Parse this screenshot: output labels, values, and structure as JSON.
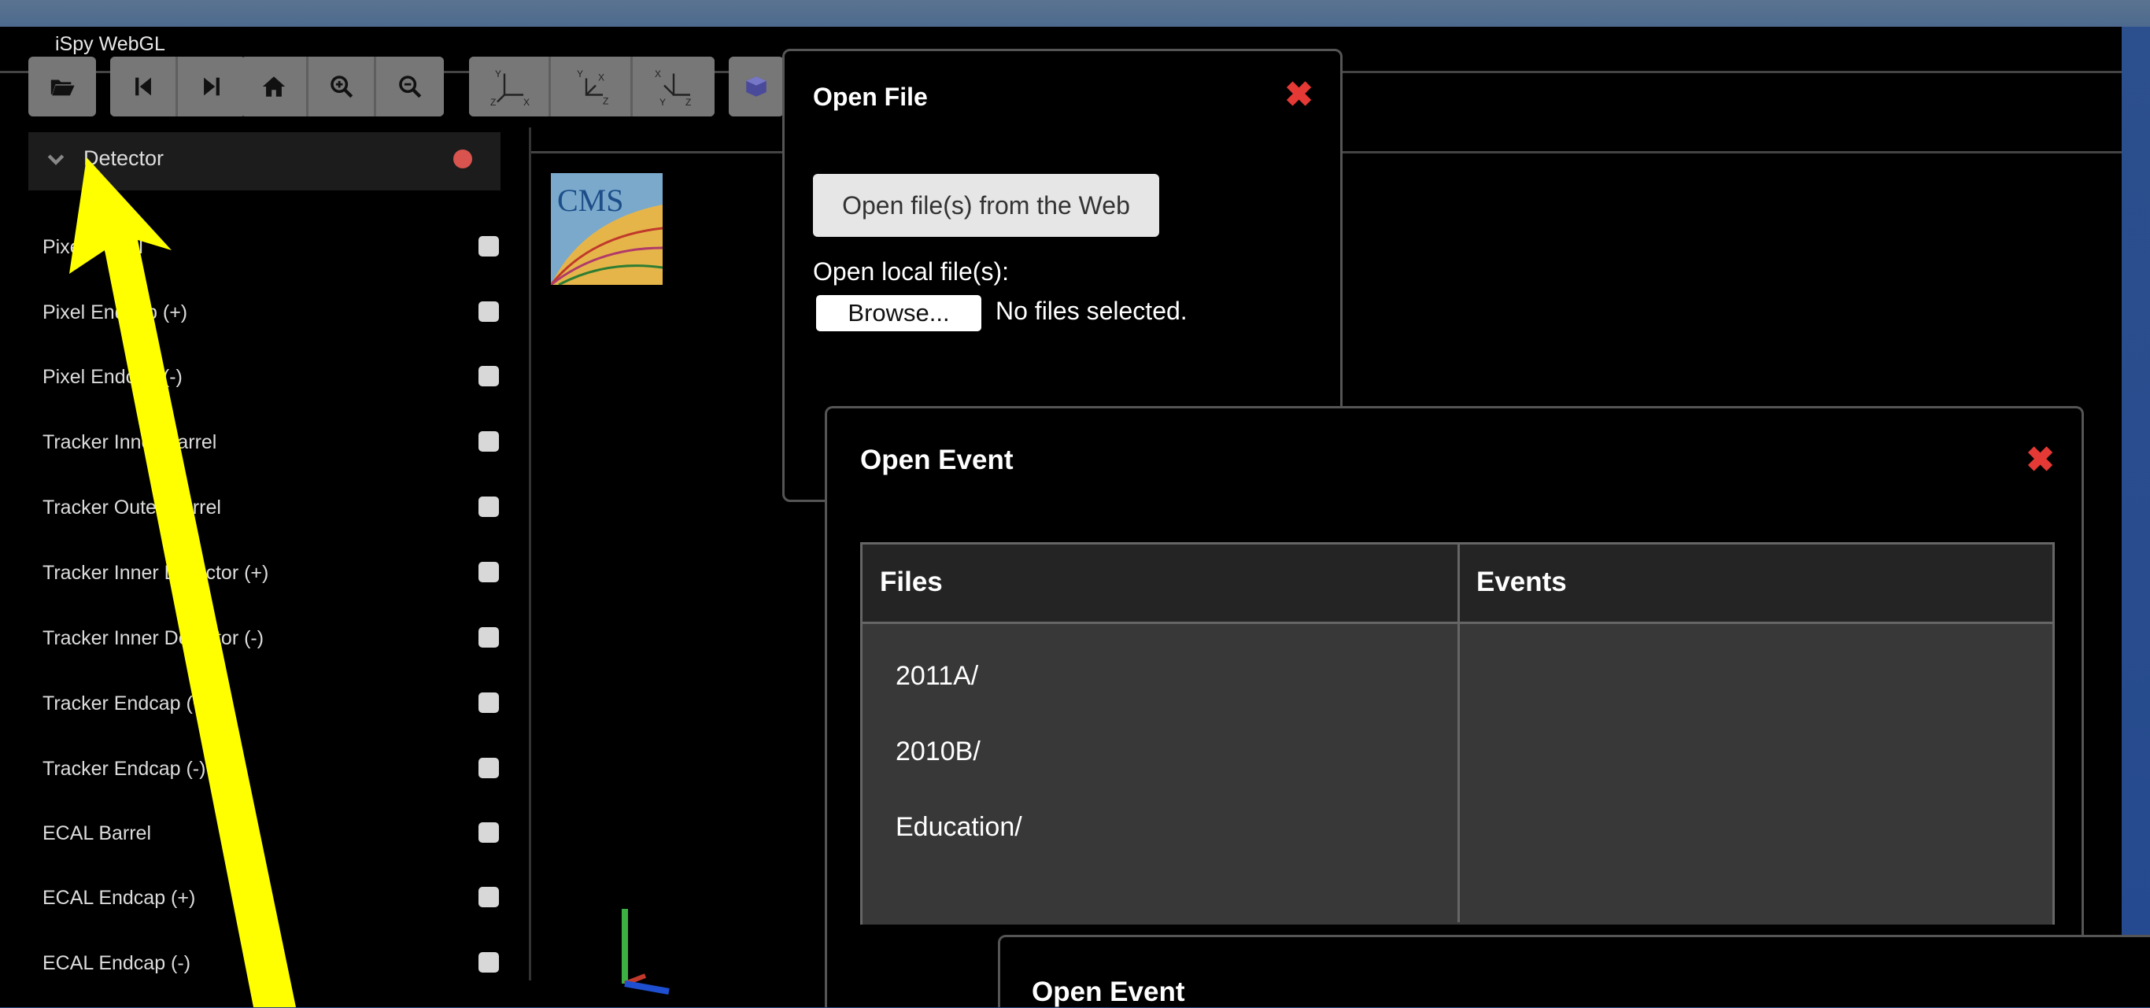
{
  "app": {
    "title": "iSpy WebGL"
  },
  "toolbar": {
    "buttons": [
      "folder-open-icon",
      "step-backward-icon",
      "step-forward-icon",
      "home-icon",
      "zoom-in-icon",
      "zoom-out-icon",
      "view-yx-icon",
      "view-yz-icon",
      "view-xy-icon",
      "cube-icon"
    ]
  },
  "sidebar": {
    "header": "Detector",
    "items": [
      {
        "label": "Pixel Barrel"
      },
      {
        "label": "Pixel Endcap (+)"
      },
      {
        "label": "Pixel Endcap (-)"
      },
      {
        "label": "Tracker Inner Barrel"
      },
      {
        "label": "Tracker Outer Barrel"
      },
      {
        "label": "Tracker Inner Detector (+)"
      },
      {
        "label": "Tracker Inner Detector (-)"
      },
      {
        "label": "Tracker Endcap (+)"
      },
      {
        "label": "Tracker Endcap (-)"
      },
      {
        "label": "ECAL Barrel"
      },
      {
        "label": "ECAL Endcap (+)"
      },
      {
        "label": "ECAL Endcap (-)"
      }
    ]
  },
  "viewport": {
    "logo_text": "CMS"
  },
  "open_file_dialog": {
    "title": "Open File",
    "web_button": "Open file(s) from the Web",
    "local_label": "Open local file(s):",
    "browse_button": "Browse...",
    "no_files": "No files selected."
  },
  "open_event_dialog": {
    "title": "Open Event",
    "col_files": "Files",
    "col_events": "Events",
    "files": [
      "2011A/",
      "2010B/",
      "Education/"
    ]
  },
  "open_event_dialog_2": {
    "title": "Open Event"
  },
  "colors": {
    "accent_close": "#e53935",
    "annotation_arrow": "#ffff00"
  }
}
